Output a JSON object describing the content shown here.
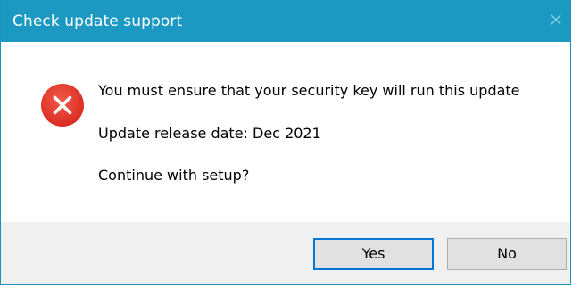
{
  "window": {
    "title": "Check update support",
    "close_icon": "close-icon"
  },
  "message": {
    "icon": "error-icon",
    "line1": "You must ensure that your security key will run this update",
    "line2": "Update release date: Dec 2021",
    "line3": "Continue with setup?"
  },
  "buttons": {
    "yes_label": "Yes",
    "no_label": "No"
  },
  "colors": {
    "titlebar": "#1b99c3",
    "error_red": "#e81123",
    "focus_border": "#0078d7",
    "footer_bg": "#f0f0f0"
  }
}
